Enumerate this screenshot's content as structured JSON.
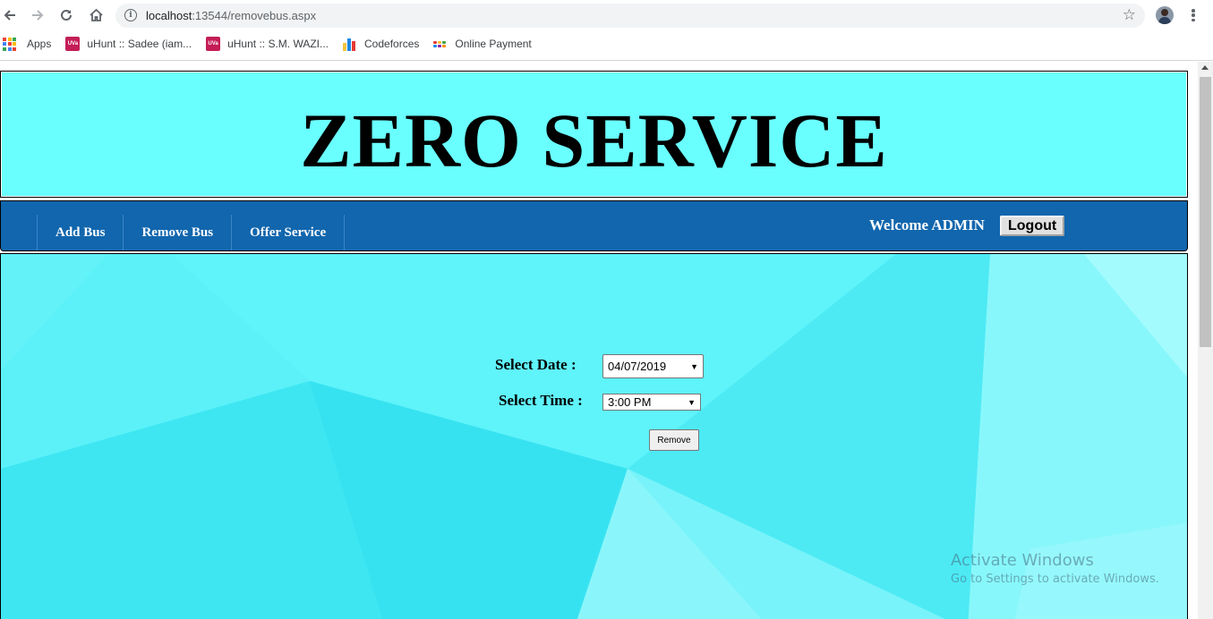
{
  "browser": {
    "url_host": "localhost",
    "url_path": ":13544/removebus.aspx",
    "bookmarks": [
      {
        "label": "Apps"
      },
      {
        "label": "uHunt :: Sadee (iam..."
      },
      {
        "label": "uHunt :: S.M. WAZI..."
      },
      {
        "label": "Codeforces"
      },
      {
        "label": "Online Payment"
      }
    ],
    "uva_badge": "UVa"
  },
  "header": {
    "title": "ZERO SERVICE",
    "background": "#6affff"
  },
  "navbar": {
    "background": "#1166ad",
    "items": [
      {
        "label": "Add Bus"
      },
      {
        "label": "Remove Bus"
      },
      {
        "label": "Offer Service"
      }
    ],
    "welcome": "Welcome ADMIN",
    "logout_label": "Logout"
  },
  "form": {
    "date_label": "Select Date :",
    "date_value": "04/07/2019",
    "time_label": "Select Time :",
    "time_value": "3:00 PM",
    "remove_label": "Remove"
  },
  "os_watermark": {
    "title": "Activate Windows",
    "subtitle": "Go to Settings to activate Windows."
  }
}
